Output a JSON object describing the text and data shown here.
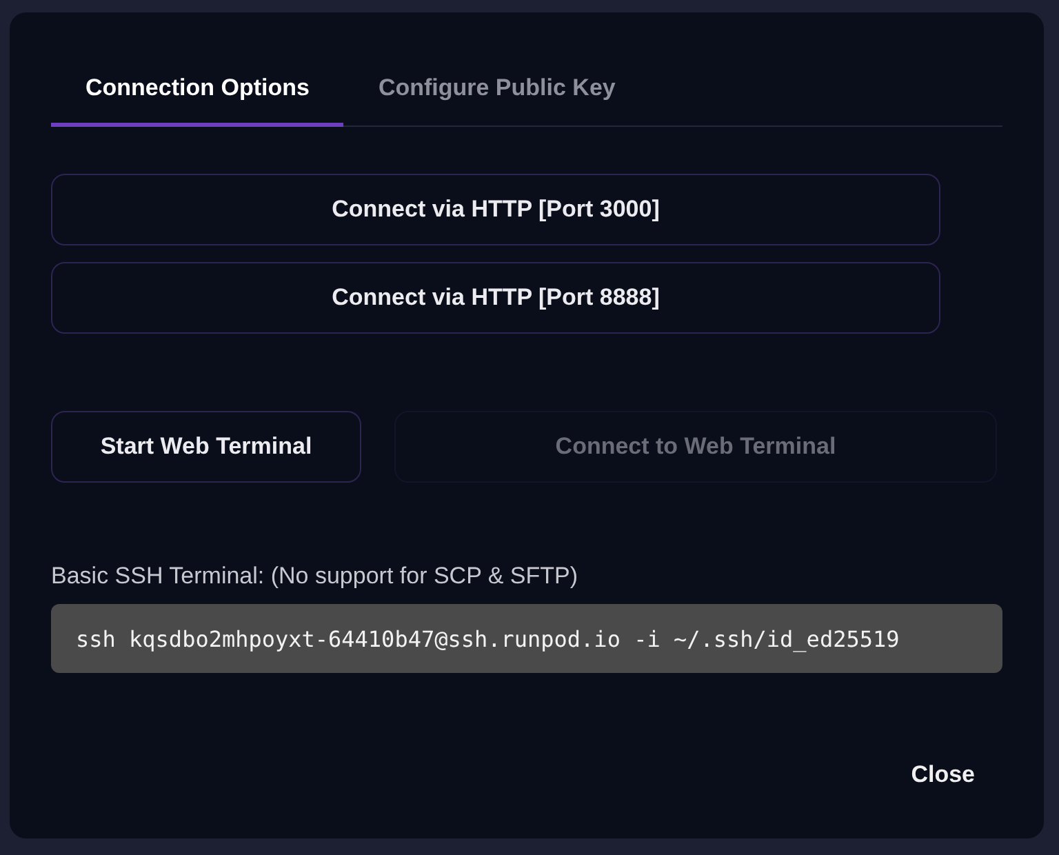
{
  "tabs": [
    {
      "label": "Connection Options",
      "selected": true
    },
    {
      "label": "Configure Public Key",
      "selected": false
    }
  ],
  "http_buttons": [
    {
      "label": "Connect via HTTP [Port 3000]",
      "disabled": false
    },
    {
      "label": "Connect via HTTP [Port 8888]",
      "disabled": false
    }
  ],
  "terminal_buttons": [
    {
      "label": "Start Web Terminal",
      "disabled": false
    },
    {
      "label": "Connect to Web Terminal",
      "disabled": true
    }
  ],
  "ssh": {
    "label": "Basic SSH Terminal: (No support for SCP & SFTP)",
    "command": "ssh kqsdbo2mhpoyxt-64410b47@ssh.runpod.io -i ~/.ssh/id_ed25519"
  },
  "close_button": "Close"
}
